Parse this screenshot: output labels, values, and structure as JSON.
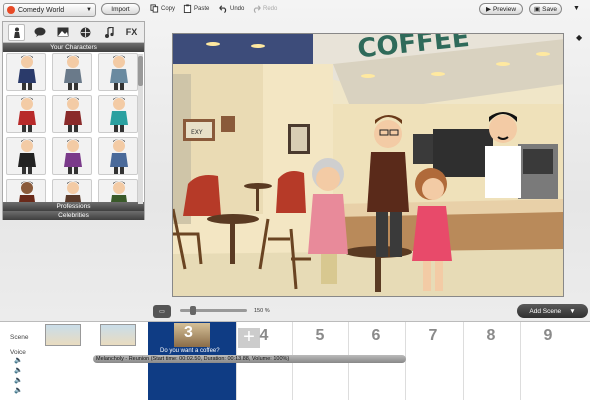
{
  "toolbar": {
    "theme": "Comedy World",
    "import_label": "Import",
    "copy_label": "Copy",
    "paste_label": "Paste",
    "undo_label": "Undo",
    "redo_label": "Redo",
    "preview_label": "Preview",
    "save_label": "Save"
  },
  "left_panel": {
    "tabs": [
      {
        "icon": "character-icon"
      },
      {
        "icon": "speech-bubble-icon"
      },
      {
        "icon": "background-icon"
      },
      {
        "icon": "prop-icon"
      },
      {
        "icon": "music-note-icon"
      },
      {
        "icon": "effects-icon",
        "text": "FX"
      }
    ],
    "section_your_characters": "Your Characters",
    "section_professions": "Professions",
    "section_celebrities": "Celebrities",
    "character_count": 12
  },
  "stage": {
    "sign_text": "COFFEE",
    "frame_text": "EXY"
  },
  "footer": {
    "zoom_level": "150 %",
    "add_scene_label": "Add Scene"
  },
  "timeline": {
    "scene_label": "Scene",
    "voice_label": "Voice",
    "selected_scene": "3",
    "scene_numbers": [
      "4",
      "5",
      "6",
      "7",
      "8",
      "9"
    ],
    "dialog_caption": "Do you want a coffee?",
    "audio_clip": "Melancholy - Reunion (Start time: 00:02.50, Duration: 00:13.88, Volume: 100%)"
  },
  "colors": {
    "selected_scene": "#0f3c84",
    "section_header": "#4a4a4a",
    "wall": "#f3e6c3",
    "floor": "#e7dbb6"
  }
}
